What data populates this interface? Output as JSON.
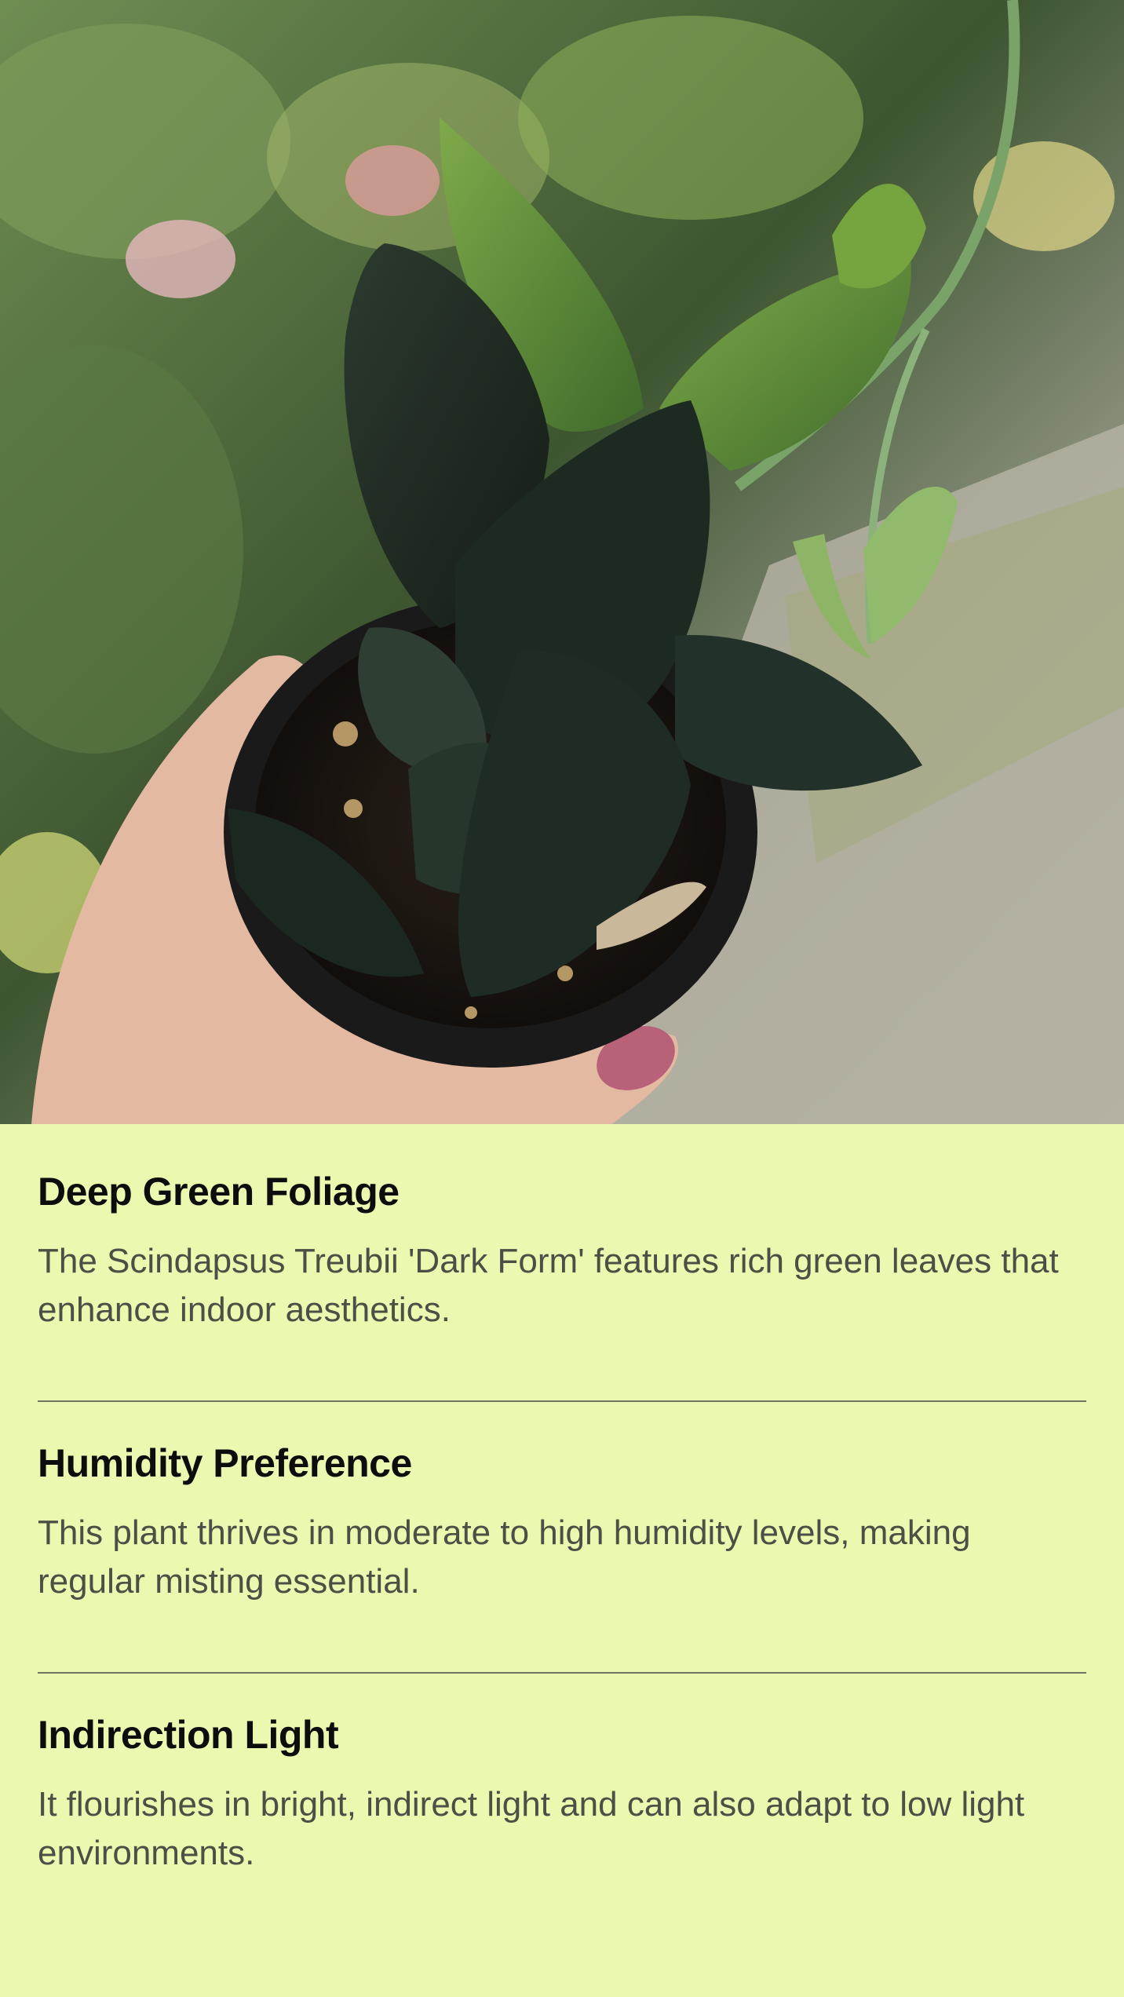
{
  "colors": {
    "background": "#ebf8b0",
    "title": "#0d0d0d",
    "body": "#4b4f46",
    "divider": "#6f7560"
  },
  "hero": {
    "image_icon": "potted-plant-photo"
  },
  "features": [
    {
      "title": "Deep Green Foliage",
      "description": "The Scindapsus Treubii 'Dark Form' features rich green leaves that enhance indoor aesthetics."
    },
    {
      "title": "Humidity Preference",
      "description": "This plant thrives in moderate to high humidity levels, making regular misting essential."
    },
    {
      "title": "Indirection Light",
      "description": "It flourishes in bright, indirect light and can also adapt to low light environments."
    }
  ]
}
